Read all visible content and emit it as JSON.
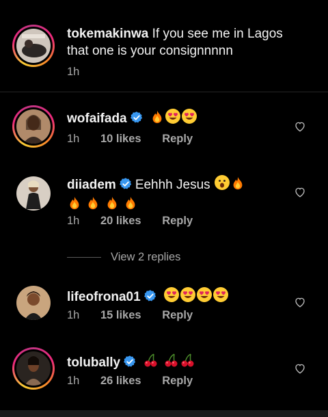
{
  "caption": {
    "username": "tokemakinwa",
    "text": "If you see me in Lagos that one is your consignnnnn",
    "time": "1h"
  },
  "comments": [
    {
      "username": "wofaifada",
      "verified": true,
      "text": "",
      "emoji": [
        "fire",
        "heart-eyes",
        "heart-eyes"
      ],
      "time": "1h",
      "likes": "10 likes",
      "reply": "Reply"
    },
    {
      "username": "diiadem",
      "verified": true,
      "text": "Eehhh Jesus",
      "emoji_line1": [
        "open-mouth",
        "fire"
      ],
      "emoji_line2": [
        "fire",
        "fire",
        "fire",
        "fire"
      ],
      "time": "1h",
      "likes": "20 likes",
      "reply": "Reply"
    },
    {
      "username": "lifeofrona01",
      "verified": true,
      "text": "",
      "emoji": [
        "heart-eyes",
        "heart-eyes",
        "heart-eyes",
        "heart-eyes"
      ],
      "time": "1h",
      "likes": "15 likes",
      "reply": "Reply"
    },
    {
      "username": "tolubally",
      "verified": true,
      "text": "",
      "emoji": [
        "cherries",
        "cherries",
        "cherries"
      ],
      "time": "1h",
      "likes": "26 likes",
      "reply": "Reply"
    }
  ],
  "view_replies": "View 2 replies",
  "colors": {
    "background": "#000000",
    "meta": "#a8a8a8",
    "verified": "#3897f0"
  }
}
